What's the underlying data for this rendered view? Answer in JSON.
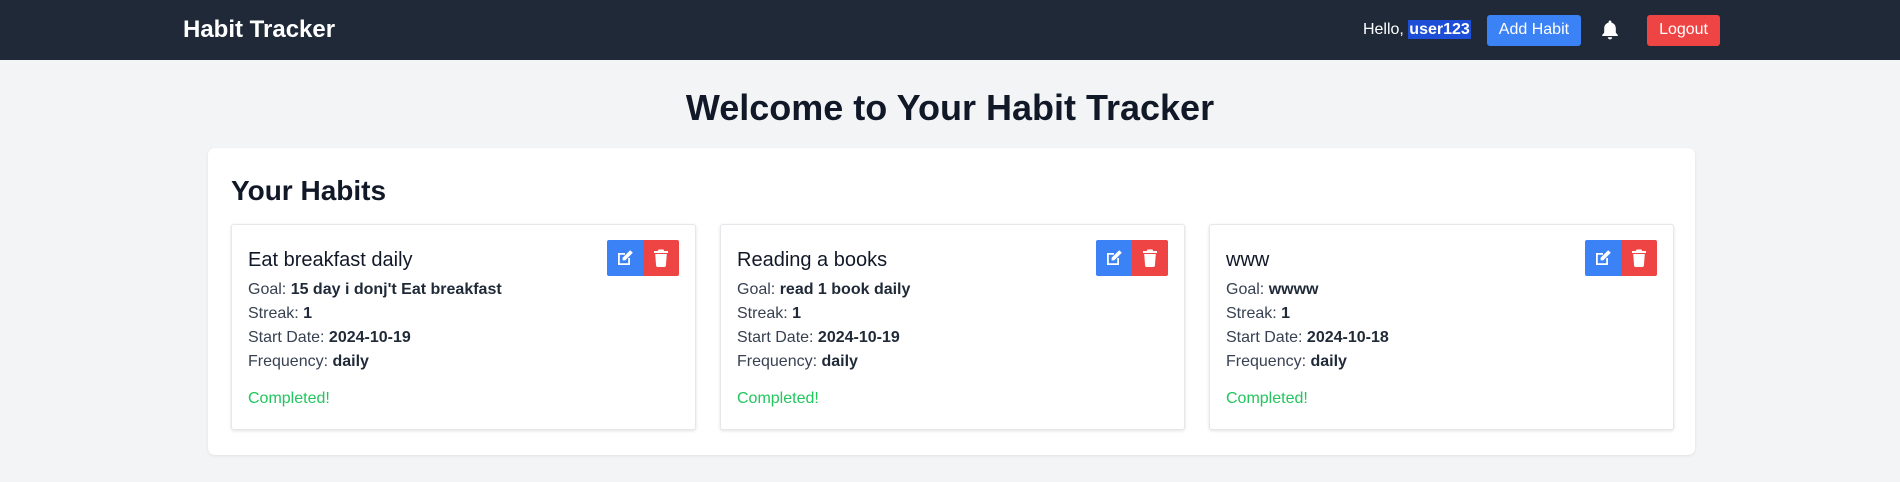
{
  "app": {
    "title": "Habit Tracker"
  },
  "nav": {
    "hello_prefix": "Hello, ",
    "username": "user123",
    "add_habit_label": "Add Habit",
    "bell_icon": "bell-icon",
    "logout_label": "Logout"
  },
  "page": {
    "heading": "Welcome to Your Habit Tracker"
  },
  "habits_section": {
    "title": "Your Habits",
    "labels": {
      "goal": "Goal: ",
      "streak": "Streak: ",
      "start_date": "Start Date: ",
      "frequency": "Frequency: "
    },
    "items": [
      {
        "name": "Eat breakfast daily",
        "goal": "15 day i donj't Eat breakfast",
        "streak": "1",
        "start_date": "2024-10-19",
        "frequency": "daily",
        "status": "Completed!"
      },
      {
        "name": "Reading a books",
        "goal": "read 1 book daily",
        "streak": "1",
        "start_date": "2024-10-19",
        "frequency": "daily",
        "status": "Completed!"
      },
      {
        "name": "www",
        "goal": "wwww",
        "streak": "1",
        "start_date": "2024-10-18",
        "frequency": "daily",
        "status": "Completed!"
      }
    ]
  },
  "colors": {
    "navbar": "#1f2937",
    "primary": "#3b82f6",
    "danger": "#ef4444",
    "success": "#22c55e",
    "background": "#f3f4f6"
  }
}
